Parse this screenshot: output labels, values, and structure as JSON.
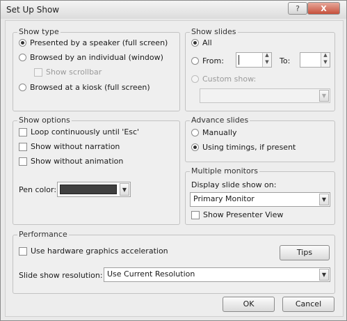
{
  "window": {
    "title": "Set Up Show",
    "help_button": "?",
    "close_button": "X"
  },
  "show_type": {
    "title": "Show type",
    "options": [
      {
        "label": "Presented by a speaker (full screen)",
        "selected": true
      },
      {
        "label": "Browsed by an individual (window)",
        "selected": false
      },
      {
        "label": "Browsed at a kiosk (full screen)",
        "selected": false
      }
    ],
    "scrollbar_label": "Show scrollbar",
    "scrollbar_checked": false
  },
  "show_slides": {
    "title": "Show slides",
    "all_label": "All",
    "from_label": "From:",
    "to_label": "To:",
    "from_value": "",
    "to_value": "",
    "custom_label": "Custom show:",
    "custom_value": "",
    "selected": "all"
  },
  "show_options": {
    "title": "Show options",
    "items": [
      {
        "label": "Loop continuously until 'Esc'",
        "checked": false
      },
      {
        "label": "Show without narration",
        "checked": false
      },
      {
        "label": "Show without animation",
        "checked": false
      }
    ],
    "pen_color_label": "Pen color:",
    "pen_color": "#404040"
  },
  "advance_slides": {
    "title": "Advance slides",
    "options": [
      {
        "label": "Manually",
        "selected": false
      },
      {
        "label": "Using timings, if present",
        "selected": true
      }
    ]
  },
  "multiple_monitors": {
    "title": "Multiple monitors",
    "display_label": "Display slide show on:",
    "display_value": "Primary Monitor",
    "presenter_view_label": "Show Presenter View",
    "presenter_view_checked": false
  },
  "performance": {
    "title": "Performance",
    "hw_accel_label": "Use hardware graphics acceleration",
    "hw_accel_checked": false,
    "tips_label": "Tips",
    "resolution_label": "Slide show resolution:",
    "resolution_value": "Use Current Resolution"
  },
  "buttons": {
    "ok": "OK",
    "cancel": "Cancel"
  },
  "icons": {
    "dropdown_arrow": "▼",
    "spin_up": "▲",
    "spin_down": "▼"
  }
}
